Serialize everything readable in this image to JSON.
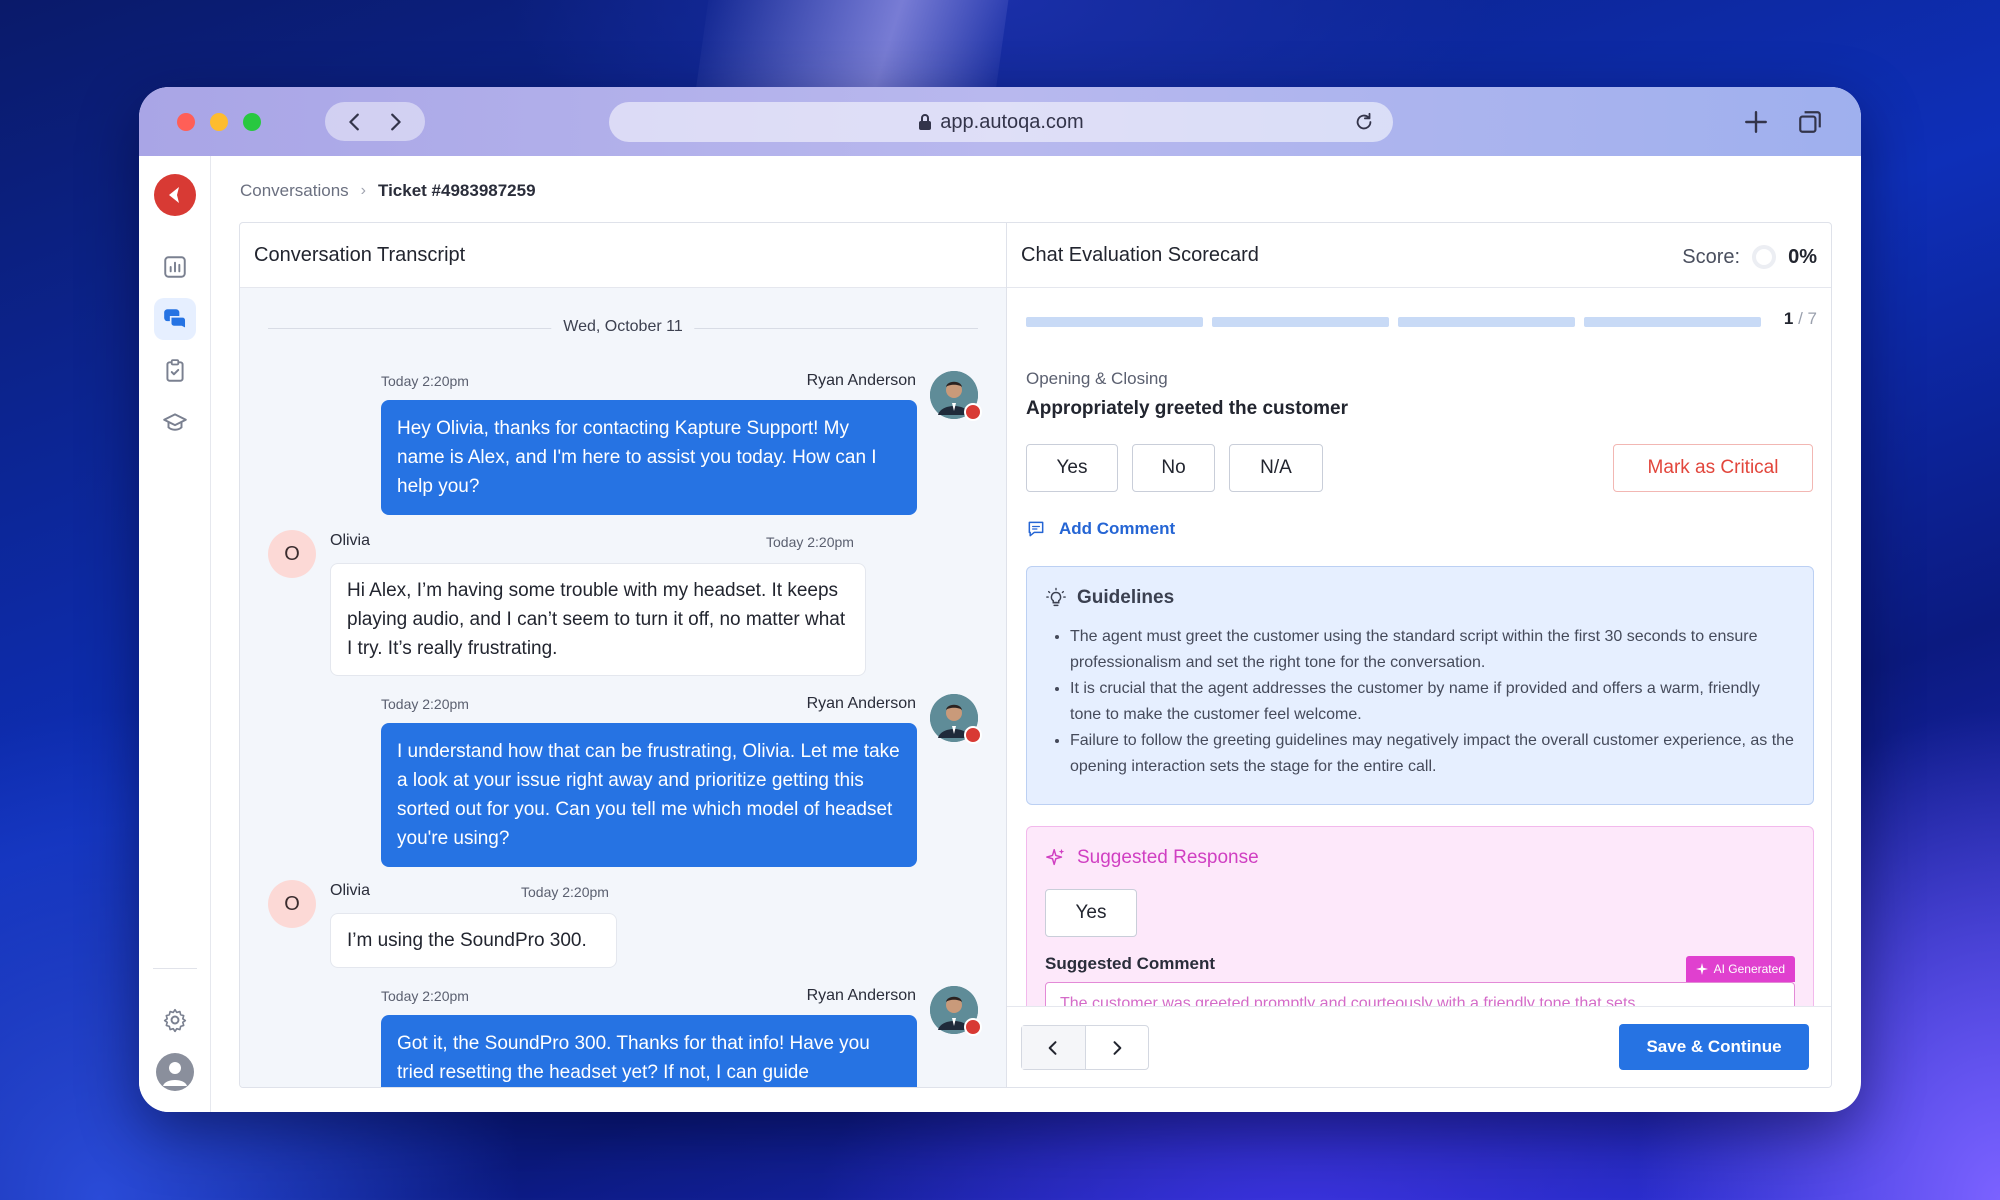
{
  "browser": {
    "url": "app.autoqa.com"
  },
  "breadcrumb": {
    "parent": "Conversations",
    "current": "Ticket #4983987259"
  },
  "transcript": {
    "title": "Conversation Transcript",
    "date": "Wed, October 11",
    "messages": [
      {
        "sender": "Ryan Anderson",
        "time": "Today 2:20pm",
        "text": "Hey Olivia, thanks for contacting Kapture Support! My name is Alex, and I'm here to assist you today. How can I help you?"
      },
      {
        "sender": "Olivia",
        "initial": "O",
        "time": "Today 2:20pm",
        "text": "Hi Alex, I’m having some trouble with my headset. It keeps playing audio, and I can’t seem to turn it off, no matter what I try. It’s really frustrating."
      },
      {
        "sender": "Ryan Anderson",
        "time": "Today 2:20pm",
        "text": "I understand how that can be frustrating, Olivia. Let me take a look at your issue right away and prioritize getting this sorted out for you. Can you tell me which model of headset you're using?"
      },
      {
        "sender": "Olivia",
        "initial": "O",
        "time": "Today 2:20pm",
        "text": "I’m using the SoundPro 300."
      },
      {
        "sender": "Ryan Anderson",
        "time": "Today 2:20pm",
        "text": "Got it, the SoundPro 300. Thanks for that info! Have you tried resetting the headset yet? If not, I can guide"
      }
    ]
  },
  "scorecard": {
    "title": "Chat Evaluation Scorecard",
    "score_label": "Score:",
    "score_value": "0%",
    "step_current": "1",
    "step_total": "/ 7",
    "category": "Opening & Closing",
    "question": "Appropriately greeted the customer",
    "options": [
      "Yes",
      "No",
      "N/A"
    ],
    "critical_label": "Mark as Critical",
    "add_comment": "Add Comment",
    "guidelines": {
      "title": "Guidelines",
      "items": [
        "The agent must greet the customer using the standard script within the first 30 seconds to ensure professionalism and set the right tone for the conversation.",
        "It is crucial that the agent addresses the customer by name if provided and offers a warm, friendly tone to make the customer feel welcome.",
        "Failure to follow the greeting guidelines may negatively impact the overall customer experience, as the opening interaction sets the stage for the entire call."
      ]
    },
    "suggested": {
      "title": "Suggested Response",
      "answer": "Yes",
      "comment_label": "Suggested Comment",
      "ai_tag": "AI Generated",
      "comment_text": "The customer was greeted promptly and courteously with a friendly tone that sets"
    },
    "save_label": "Save & Continue"
  },
  "colors": {
    "primary": "#2673e3",
    "critical": "#e2463c",
    "ai_accent": "#e040cf",
    "brand": "#d83a34"
  }
}
